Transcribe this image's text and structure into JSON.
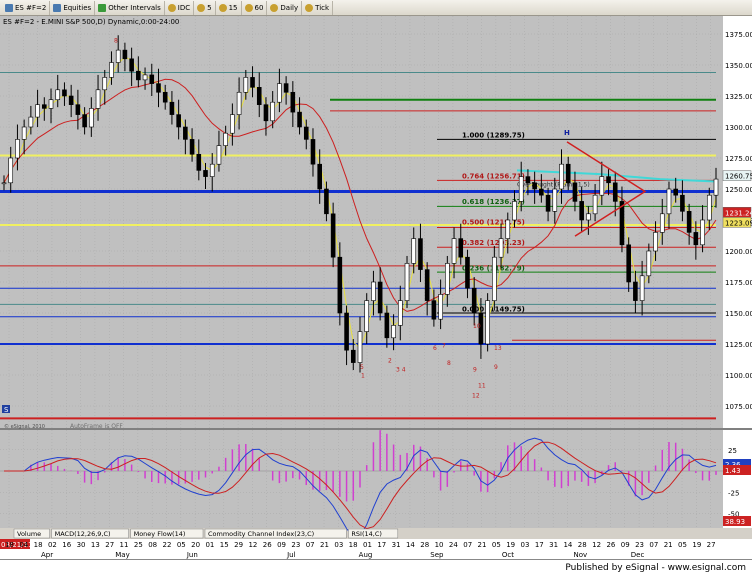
{
  "toolbar": {
    "symbol": "ES #F=2",
    "equities": "Equities",
    "other_intervals": "Other Intervals",
    "idc": "IDC",
    "n5": "5",
    "n15": "15",
    "n60": "60",
    "daily": "Daily",
    "tick": "Tick"
  },
  "chart": {
    "title": "ES #F=2 - E.MINI S&P 500,D) Dynamic,0:00-24:00",
    "watermark": "© eSignal, 2010",
    "autoframe": "AutoFrame is OFF",
    "date_badge": "03/21/11",
    "published": "Published by eSignal - www.esignal.com"
  },
  "price_axis": [
    "1375.00",
    "1350.00",
    "1325.00",
    "1300.00",
    "1275.00",
    "1250.00",
    "1225.00",
    "1200.00",
    "1175.00",
    "1150.00",
    "1125.00",
    "1100.00",
    "1075.00"
  ],
  "price_badges": [
    {
      "text": "1260.75",
      "bg": "#e8f4f4",
      "fg": "#000000"
    },
    {
      "text": "1231.24",
      "bg": "#cc2222",
      "fg": "#ffffff"
    },
    {
      "text": "1223.09",
      "bg": "#f0e060",
      "fg": "#000000"
    }
  ],
  "fib_levels": [
    {
      "label": "1.000 (1289.75)",
      "color": "#000000"
    },
    {
      "label": "0.764 (1256.71)",
      "color": "#b01818"
    },
    {
      "label": "0.618 (1236.27)",
      "color": "#106010"
    },
    {
      "label": "0.500 (1219.75)",
      "color": "#b01818"
    },
    {
      "label": "0.382 (1203.23)",
      "color": "#b01818"
    },
    {
      "label": "0.236 (1182.79)",
      "color": "#106010"
    },
    {
      "label": "0.000 (1149.75)",
      "color": "#000000"
    }
  ],
  "overbought_label": "OverBought (Frame 1.5)",
  "h_marker": "H",
  "month_labels": [
    "Apr",
    "May",
    "Jun",
    "Jul",
    "Aug",
    "Sep",
    "Oct",
    "Nov",
    "Dec"
  ],
  "day_labels": [
    "18",
    "04",
    "18",
    "02",
    "16",
    "30",
    "13",
    "27",
    "11",
    "25",
    "08",
    "22",
    "05",
    "20",
    "01",
    "15",
    "29",
    "12",
    "26",
    "09",
    "23",
    "07",
    "21",
    "03",
    "18",
    "01",
    "17",
    "31",
    "14",
    "28",
    "10",
    "24",
    "07",
    "21",
    "05",
    "19",
    "03",
    "17",
    "31",
    "14",
    "28",
    "12",
    "26",
    "09",
    "23",
    "07",
    "21",
    "05",
    "19",
    "27"
  ],
  "indicator_tabs": [
    "Volume",
    "MACD(12,26,9,C)",
    "Money Flow(14)",
    "Commodity Channel Index(23,C)",
    "RSI(14,C)"
  ],
  "macd_axis": [
    "25",
    "0",
    "-25",
    "-50"
  ],
  "macd_badges": [
    {
      "text": "2.36",
      "bg": "#2040c0",
      "fg": "#ffffff"
    },
    {
      "text": "1.43",
      "bg": "#cc2222",
      "fg": "#ffffff"
    },
    {
      "text": "38.93",
      "bg": "#cc2222",
      "fg": "#ffffff"
    }
  ],
  "td_counts": [
    "1",
    "2",
    "3 4",
    "5",
    "6",
    "7",
    "8",
    "9",
    "10",
    "11",
    "12",
    "13",
    "8",
    "9"
  ]
}
